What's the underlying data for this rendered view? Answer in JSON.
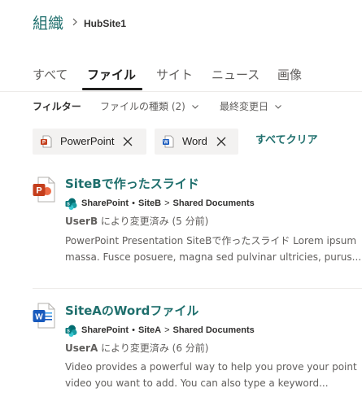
{
  "breadcrumb": {
    "root": "組織",
    "current": "HubSite1"
  },
  "tabs": [
    {
      "label": "すべて",
      "active": false
    },
    {
      "label": "ファイル",
      "active": true
    },
    {
      "label": "サイト",
      "active": false
    },
    {
      "label": "ニュース",
      "active": false
    },
    {
      "label": "画像",
      "active": false
    }
  ],
  "filters": {
    "label": "フィルター",
    "file_type": "ファイルの種類 (2)",
    "modified": "最終変更日"
  },
  "chips": [
    {
      "label": "PowerPoint",
      "icon": "powerpoint-icon"
    },
    {
      "label": "Word",
      "icon": "word-icon"
    }
  ],
  "clear_all": "すべてクリア",
  "results": [
    {
      "title": "SiteBで作ったスライド",
      "icon": "powerpoint-icon",
      "path": [
        "SharePoint",
        "SiteB",
        "Shared Documents"
      ],
      "author": "UserB",
      "modified_text": "により変更済み (5 分前)",
      "description_line1": "PowerPoint Presentation SiteBで作ったスライド Lorem ipsum",
      "description_line2": "massa. Fusce posuere, magna sed pulvinar ultricies, purus..."
    },
    {
      "title": "SiteAのWordファイル",
      "icon": "word-icon",
      "path": [
        "SharePoint",
        "SiteA",
        "Shared Documents"
      ],
      "author": "UserA",
      "modified_text": "により変更済み (6 分前)",
      "description_line1": "Video provides a powerful way to help you prove your point",
      "description_line2": "video you want to add. You can also type a keyword..."
    }
  ],
  "colors": {
    "accent": "#1f6f6d",
    "powerpoint": "#c43e1c",
    "word": "#185abd",
    "sharepoint": "#036c70"
  }
}
